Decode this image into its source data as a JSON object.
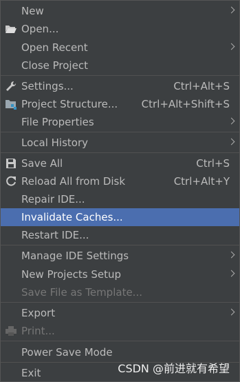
{
  "menu": {
    "new": "New",
    "open": "Open...",
    "open_recent": "Open Recent",
    "close_project": "Close Project",
    "settings": "Settings...",
    "settings_shortcut": "Ctrl+Alt+S",
    "project_structure": "Project Structure...",
    "project_structure_shortcut": "Ctrl+Alt+Shift+S",
    "file_properties": "File Properties",
    "local_history": "Local History",
    "save_all": "Save All",
    "save_all_shortcut": "Ctrl+S",
    "reload_all": "Reload All from Disk",
    "reload_all_shortcut": "Ctrl+Alt+Y",
    "repair_ide": "Repair IDE...",
    "invalidate_caches": "Invalidate Caches...",
    "restart_ide": "Restart IDE...",
    "manage_ide_settings": "Manage IDE Settings",
    "new_projects_setup": "New Projects Setup",
    "save_file_as_template": "Save File as Template...",
    "export": "Export",
    "print": "Print...",
    "power_save_mode": "Power Save Mode",
    "exit": "Exit"
  },
  "watermark": "CSDN @前进就有希望",
  "colors": {
    "background": "#3c3f41",
    "selected": "#4b6eaf",
    "text": "#bbbbbb",
    "disabled_text": "#777777"
  }
}
